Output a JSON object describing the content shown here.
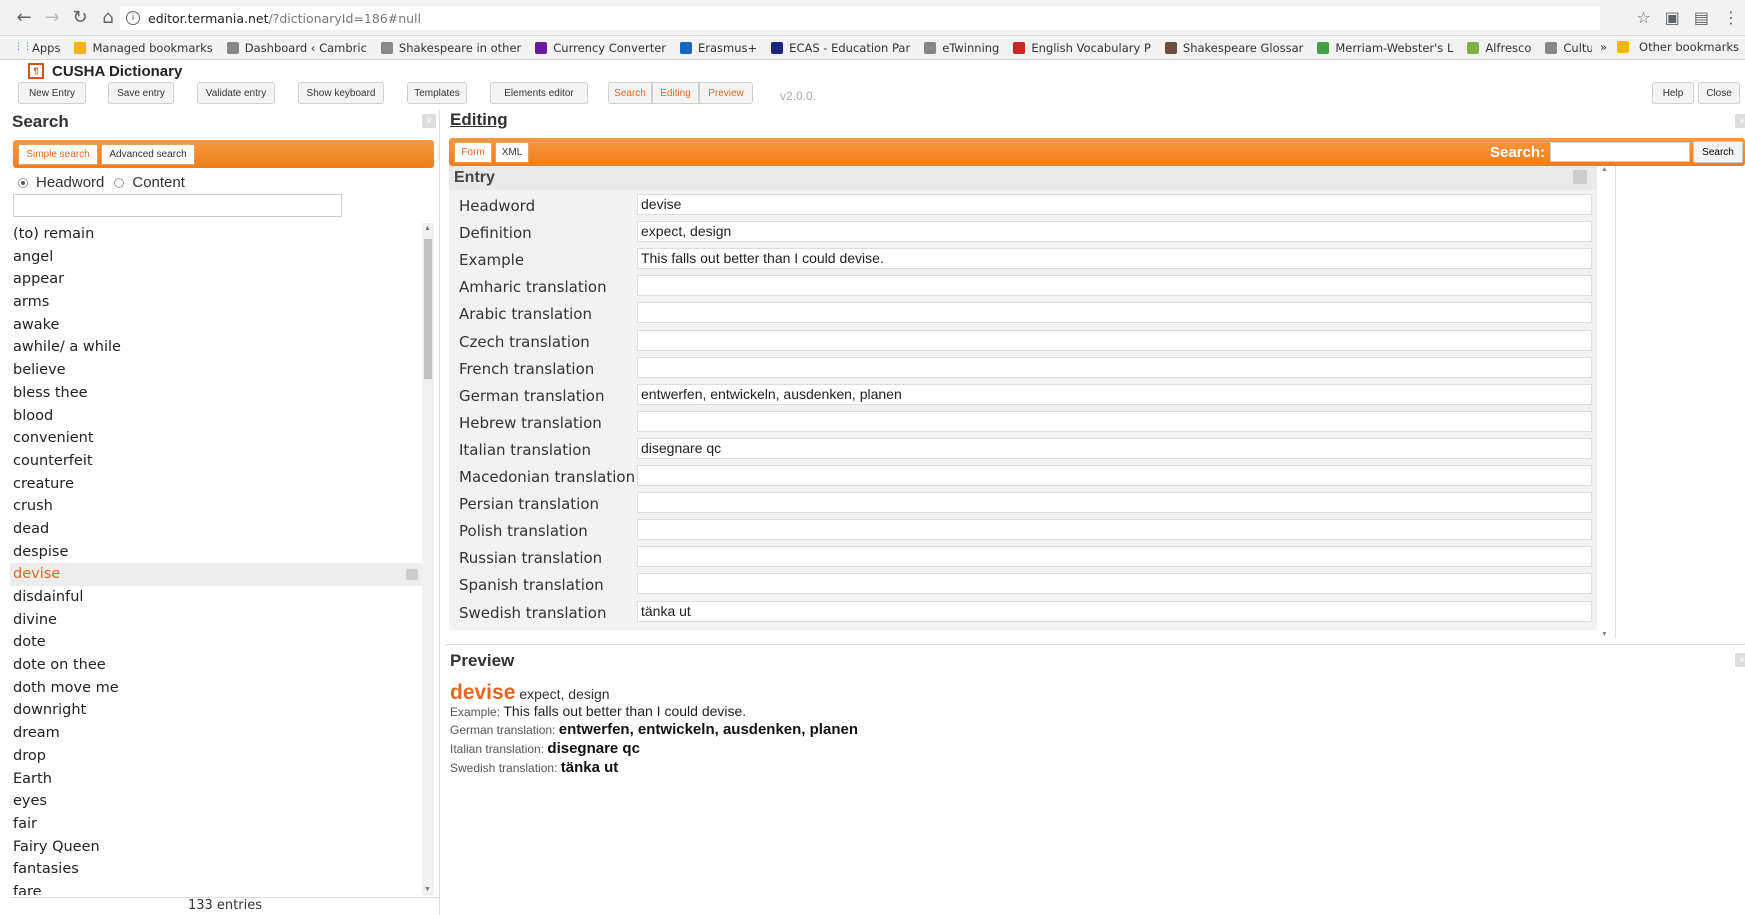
{
  "browser": {
    "url_host": "editor.termania.net",
    "url_path": "/?dictionaryId=186#null",
    "bookmarks": [
      "Apps",
      "Managed bookmarks",
      "Dashboard ‹ Cambric",
      "Shakespeare in other",
      "Currency Converter",
      "Erasmus+",
      "ECAS - Education Par",
      "eTwinning",
      "English Vocabulary P",
      "Shakespeare Glossar",
      "Merriam-Webster's L",
      "Alfresco",
      "CultureShake"
    ],
    "other_bookmarks": "Other bookmarks",
    "more": "»"
  },
  "app": {
    "title": "CUSHA Dictionary",
    "version": "v2.0.0."
  },
  "toolbar": {
    "new_entry": "New Entry",
    "save_entry": "Save entry",
    "validate_entry": "Validate entry",
    "show_keyboard": "Show keyboard",
    "templates": "Templates",
    "elements_editor": "Elements editor",
    "search": "Search",
    "editing": "Editing",
    "preview": "Preview",
    "help": "Help",
    "close": "Close"
  },
  "search_panel": {
    "title": "Search",
    "tab_simple": "Simple search",
    "tab_advanced": "Advanced search",
    "radio_headword": "Headword",
    "radio_content": "Content",
    "words": [
      "(to) remain",
      "angel",
      "appear",
      "arms",
      "awake",
      "awhile/ a while",
      "believe",
      "bless thee",
      "blood",
      "convenient",
      "counterfeit",
      "creature",
      "crush",
      "dead",
      "despise",
      "devise",
      "disdainful",
      "divine",
      "dote",
      "dote on thee",
      "doth move me",
      "downright",
      "dream",
      "drop",
      "Earth",
      "eyes",
      "fair",
      "Fairy Queen",
      "fantasies",
      "fare"
    ],
    "selected_word": "devise",
    "entries_count": "133 entries"
  },
  "editing": {
    "title": "Editing",
    "tab_form": "Form",
    "tab_xml": "XML",
    "search_label": "Search:",
    "search_button": "Search",
    "entry_title": "Entry",
    "fields": [
      {
        "label": "Headword",
        "value": "devise"
      },
      {
        "label": "Definition",
        "value": "expect, design"
      },
      {
        "label": "Example",
        "value": "This falls out better than I could devise."
      },
      {
        "label": "Amharic translation",
        "value": ""
      },
      {
        "label": "Arabic translation",
        "value": ""
      },
      {
        "label": "Czech translation",
        "value": ""
      },
      {
        "label": "French translation",
        "value": ""
      },
      {
        "label": "German translation",
        "value": "entwerfen, entwickeln, ausdenken, planen"
      },
      {
        "label": "Hebrew translation",
        "value": ""
      },
      {
        "label": "Italian translation",
        "value": "disegnare qc"
      },
      {
        "label": "Macedonian translation",
        "value": ""
      },
      {
        "label": "Persian translation",
        "value": ""
      },
      {
        "label": "Polish translation",
        "value": ""
      },
      {
        "label": "Russian translation",
        "value": ""
      },
      {
        "label": "Spanish translation",
        "value": ""
      },
      {
        "label": "Swedish translation",
        "value": "tänka ut"
      }
    ]
  },
  "preview": {
    "title": "Preview",
    "headword": "devise",
    "definition": "expect, design",
    "example_label": "Example:",
    "example": "This falls out better than I could devise.",
    "german_label": "German translation:",
    "german": "entwerfen, entwickeln, ausdenken, planen",
    "italian_label": "Italian translation:",
    "italian": "disegnare qc",
    "swedish_label": "Swedish translation:",
    "swedish": "tänka ut"
  },
  "colors": {
    "accent": "#ef7d1a",
    "selected_text": "#e8661f"
  }
}
